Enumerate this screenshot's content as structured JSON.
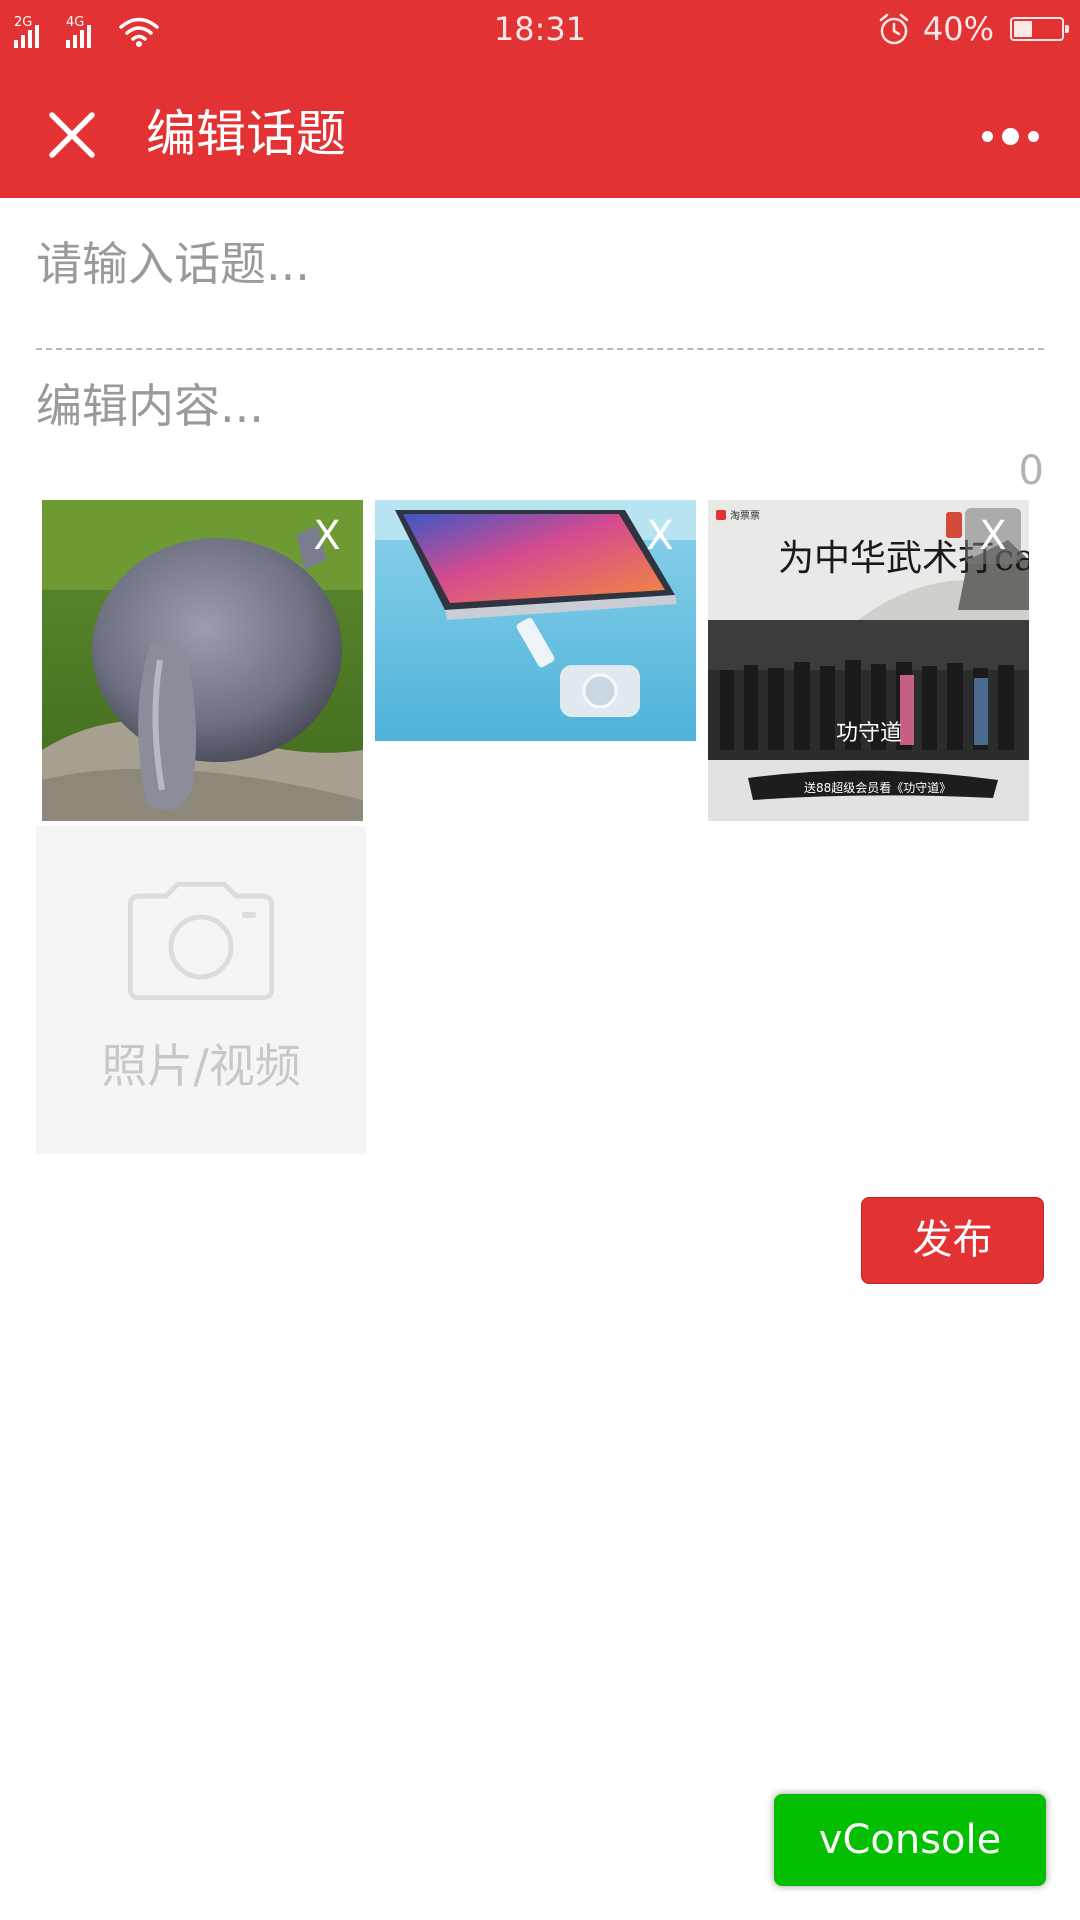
{
  "status_bar": {
    "network_1": "2G",
    "network_2": "4G",
    "time": "18:31",
    "battery_percent": "40%",
    "battery_level": 0.4
  },
  "header": {
    "title": "编辑话题",
    "close_icon": "close-icon",
    "more_icon": "more-dots-icon"
  },
  "form": {
    "topic_placeholder": "请输入话题...",
    "topic_value": "",
    "content_placeholder": "编辑内容...",
    "content_value": "",
    "char_count": "0"
  },
  "media": {
    "items": [
      {
        "name": "chinchilla-photo",
        "remove_label": "X"
      },
      {
        "name": "phone-charging-photo",
        "remove_label": "X"
      },
      {
        "name": "kungfu-poster-photo",
        "remove_label": "X"
      }
    ],
    "poster_texts": {
      "brand": "淘票票",
      "title": "为中华武术打call",
      "subtitle": "功守道",
      "banner": "送88超级会员看《功守道》"
    },
    "add_label": "照片/视频",
    "add_icon": "camera-icon"
  },
  "actions": {
    "publish_label": "发布"
  },
  "debug": {
    "vconsole_label": "vConsole"
  },
  "colors": {
    "brand_red": "#e33234",
    "vconsole_green": "#04be02"
  }
}
